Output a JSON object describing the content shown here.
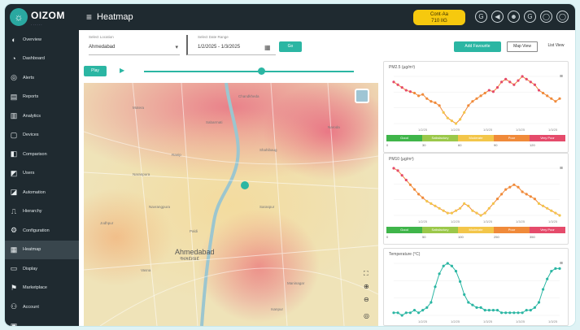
{
  "header": {
    "logo": "OIZOM",
    "logo_mark": "☼",
    "logo_sub": "· · · · · ·",
    "menu_icon": "≡",
    "title": "Heatmap",
    "aqi_label": "Cont·Aa",
    "aqi_value": "710 IIG",
    "icons": [
      "G",
      "◀",
      "☻",
      "G",
      "◯",
      "◯"
    ]
  },
  "sidebar": {
    "items": [
      {
        "icon": "◐",
        "label": "Overview"
      },
      {
        "icon": "◔",
        "label": "Dashboard"
      },
      {
        "icon": "◎",
        "label": "Alerts"
      },
      {
        "icon": "▤",
        "label": "Reports"
      },
      {
        "icon": "▥",
        "label": "Analytics"
      },
      {
        "icon": "▢",
        "label": "Devices"
      },
      {
        "icon": "◧",
        "label": "Comparison"
      },
      {
        "icon": "◩",
        "label": "Users"
      },
      {
        "icon": "◪",
        "label": "Automation"
      },
      {
        "icon": "⎍",
        "label": "Hierarchy"
      },
      {
        "icon": "⚙",
        "label": "Configuration"
      },
      {
        "icon": "▦",
        "label": "Heatmap"
      },
      {
        "icon": "▭",
        "label": "Display"
      },
      {
        "icon": "⚑",
        "label": "Marketplace"
      },
      {
        "icon": "⚇",
        "label": "Account"
      },
      {
        "icon": "▣",
        "label": ""
      }
    ],
    "active_index": 11
  },
  "toolbar": {
    "location_label": "Select Location",
    "location_value": "Ahmedabad",
    "dropdown_arrow": "▾",
    "date_label": "Select Date Range",
    "date_value": "1/2/2025 - 1/3/2025",
    "calendar_icon": "▦",
    "go_label": "Go",
    "primary_label": "Add Favourite",
    "view_label": "Map View",
    "view2_label": "List View"
  },
  "player": {
    "speed_label": "Play",
    "play_icon": "▶"
  },
  "map": {
    "city_label": "Ahmedabad",
    "city_label_local": "અમદાવાદ",
    "area_labels": [
      "Motera",
      "Sabarmati",
      "Chandkheda",
      "Naroda",
      "Ranip",
      "Shahibaug",
      "Saraspur",
      "Naranpura",
      "Navrangpura",
      "Vasna",
      "Paldi",
      "Jodhpur",
      "Maninagar",
      "Isanpur"
    ],
    "controls": [
      "⛶",
      "⊕",
      "⊖",
      "◎"
    ]
  },
  "cards": [
    {
      "title": "PM2.5 (µg/m³)",
      "menu_icon": "≡",
      "levels": [
        "Good",
        "Satisfactory",
        "Moderate",
        "Poor",
        "Very Poor"
      ],
      "thresholds": [
        "0",
        "30",
        "60",
        "90",
        "120"
      ],
      "xticks": [
        "1/2/25",
        "1/2/25",
        "1/3/25",
        "1/3/25",
        "1/3/25"
      ]
    },
    {
      "title": "PM10 (µg/m³)",
      "menu_icon": "≡",
      "levels": [
        "Good",
        "Satisfactory",
        "Moderate",
        "Poor",
        "Very Poor"
      ],
      "thresholds": [
        "0",
        "50",
        "100",
        "250",
        "350"
      ],
      "xticks": [
        "1/2/25",
        "1/2/25",
        "1/3/25",
        "1/3/25",
        "1/3/25"
      ]
    },
    {
      "title": "Temperature (°C)",
      "menu_icon": "≡",
      "xticks": [
        "1/2/25",
        "1/2/25",
        "1/3/25",
        "1/3/25",
        "1/3/25"
      ]
    }
  ],
  "chart_data": [
    {
      "type": "line",
      "y": [
        72,
        70,
        68,
        66,
        65,
        64,
        62,
        63,
        60,
        58,
        57,
        55,
        50,
        46,
        44,
        42,
        45,
        50,
        55,
        58,
        60,
        62,
        64,
        66,
        65,
        68,
        72,
        74,
        72,
        70,
        73,
        76,
        74,
        72,
        70,
        66,
        64,
        62,
        60,
        58,
        60
      ]
    },
    {
      "type": "line",
      "y": [
        80,
        78,
        74,
        70,
        66,
        62,
        58,
        55,
        52,
        50,
        48,
        46,
        44,
        42,
        42,
        44,
        46,
        50,
        48,
        44,
        42,
        40,
        42,
        46,
        50,
        54,
        58,
        62,
        64,
        66,
        64,
        60,
        58,
        56,
        54,
        50,
        48,
        46,
        44,
        42,
        40
      ]
    },
    {
      "type": "line",
      "y": [
        18,
        18,
        17,
        18,
        18,
        19,
        18,
        19,
        20,
        22,
        28,
        33,
        36,
        37,
        36,
        34,
        30,
        25,
        22,
        21,
        20,
        20,
        19,
        19,
        19,
        19,
        18,
        18,
        18,
        18,
        18,
        18,
        19,
        19,
        20,
        22,
        27,
        31,
        34,
        35,
        35
      ]
    }
  ],
  "colors": {
    "accent": "#2bb6a3",
    "sidebar": "#1f2a30",
    "aqi": "#f6c90e",
    "good": "#3fb54a",
    "satisfactory": "#9bc84a",
    "moderate": "#f3c64a",
    "poor": "#f08a3a",
    "very_poor": "#e54b6b"
  }
}
